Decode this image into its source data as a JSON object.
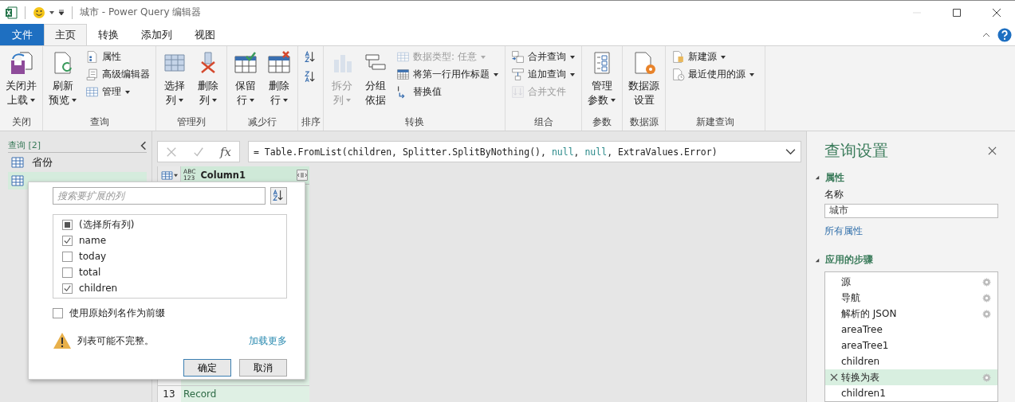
{
  "window": {
    "title": "城市 - Power Query 编辑器"
  },
  "tabs": [
    {
      "label": "文件",
      "kind": "file",
      "selected": false
    },
    {
      "label": "主页",
      "kind": "tab",
      "selected": true
    },
    {
      "label": "转换",
      "kind": "tab",
      "selected": false
    },
    {
      "label": "添加列",
      "kind": "tab",
      "selected": false
    },
    {
      "label": "视图",
      "kind": "tab",
      "selected": false
    }
  ],
  "ribbon": {
    "groups": [
      {
        "label": "关闭",
        "items": [
          {
            "kind": "large",
            "lines": [
              "关闭并",
              "上载"
            ],
            "dropdown": true,
            "disabled": false
          }
        ]
      },
      {
        "label": "查询",
        "items": [
          {
            "kind": "large",
            "lines": [
              "刷新",
              "预览"
            ],
            "dropdown": true,
            "disabled": false
          },
          {
            "kind": "stack",
            "children": [
              {
                "label": "属性",
                "dropdown": false,
                "disabled": false
              },
              {
                "label": "高级编辑器",
                "dropdown": false,
                "disabled": false
              },
              {
                "label": "管理",
                "dropdown": true,
                "disabled": false
              }
            ]
          }
        ]
      },
      {
        "label": "管理列",
        "items": [
          {
            "kind": "large",
            "lines": [
              "选择",
              "列"
            ],
            "dropdown": true,
            "disabled": false
          },
          {
            "kind": "large",
            "lines": [
              "删除",
              "列"
            ],
            "dropdown": true,
            "disabled": false
          }
        ]
      },
      {
        "label": "减少行",
        "items": [
          {
            "kind": "large",
            "lines": [
              "保留",
              "行"
            ],
            "dropdown": true,
            "disabled": false
          },
          {
            "kind": "large",
            "lines": [
              "删除",
              "行"
            ],
            "dropdown": true,
            "disabled": false
          }
        ]
      },
      {
        "label": "排序",
        "items": [
          {
            "kind": "icons"
          }
        ]
      },
      {
        "label": "转换",
        "items": [
          {
            "kind": "large",
            "lines": [
              "拆分",
              "列"
            ],
            "dropdown": true,
            "disabled": true
          },
          {
            "kind": "large",
            "lines": [
              "分组",
              "依据"
            ],
            "dropdown": false,
            "disabled": false
          },
          {
            "kind": "stack",
            "children": [
              {
                "label": "数据类型: 任意",
                "dropdown": true,
                "disabled": true
              },
              {
                "label": "将第一行用作标题",
                "dropdown": true,
                "disabled": false
              },
              {
                "label": "替换值",
                "dropdown": false,
                "disabled": false
              }
            ]
          }
        ]
      },
      {
        "label": "组合",
        "items": [
          {
            "kind": "stack",
            "children": [
              {
                "label": "合并查询",
                "dropdown": true,
                "disabled": false
              },
              {
                "label": "追加查询",
                "dropdown": true,
                "disabled": false
              },
              {
                "label": "合并文件",
                "dropdown": false,
                "disabled": true
              }
            ]
          }
        ]
      },
      {
        "label": "参数",
        "items": [
          {
            "kind": "large",
            "lines": [
              "管理",
              "参数"
            ],
            "dropdown": true,
            "disabled": false
          }
        ]
      },
      {
        "label": "数据源",
        "items": [
          {
            "kind": "large",
            "lines": [
              "数据源",
              "设置"
            ],
            "dropdown": false,
            "disabled": false
          }
        ]
      },
      {
        "label": "新建查询",
        "items": [
          {
            "kind": "stack",
            "children": [
              {
                "label": "新建源",
                "dropdown": true,
                "disabled": false
              },
              {
                "label": "最近使用的源",
                "dropdown": true,
                "disabled": false
              }
            ]
          }
        ]
      }
    ]
  },
  "queries_pane": {
    "header": "查询 [2]",
    "items": [
      {
        "label": "省份",
        "selected": false
      },
      {
        "selected": true
      }
    ]
  },
  "formula_bar": {
    "fx": "fx",
    "segments": [
      {
        "text": "= Table.FromList(children, Splitter.SplitByNothing(), ",
        "kind": "code"
      },
      {
        "text": "null",
        "kind": "keyword"
      },
      {
        "text": ", ",
        "kind": "code"
      },
      {
        "text": "null",
        "kind": "keyword"
      },
      {
        "text": ", ExtraValues.Error)",
        "kind": "code"
      }
    ]
  },
  "table": {
    "column": {
      "type": [
        "ABC",
        "123"
      ],
      "name": "Column1"
    },
    "rows": [
      {
        "index": "13",
        "value": "Record"
      }
    ]
  },
  "expand_popup": {
    "search": {
      "placeholder": "搜索要扩展的列"
    },
    "select_all": {
      "label": "(选择所有列)",
      "partial": true
    },
    "columns": [
      {
        "label": "name",
        "checked": true
      },
      {
        "label": "today",
        "checked": false
      },
      {
        "label": "total",
        "checked": false
      },
      {
        "label": "children",
        "checked": true
      }
    ],
    "prefix": {
      "label": "使用原始列名作为前缀",
      "checked": false
    },
    "warning": "列表可能不完整。",
    "load_more": "加载更多",
    "buttons": [
      {
        "label": "确定",
        "kind": "default"
      },
      {
        "label": "取消",
        "kind": "normal"
      }
    ]
  },
  "settings": {
    "title": "查询设置",
    "properties": {
      "heading": "属性",
      "expanded": true,
      "name_label": "名称",
      "name_value": "城市",
      "all_link": "所有属性"
    },
    "steps": {
      "heading": "应用的步骤",
      "expanded": true,
      "items": [
        {
          "label": "源",
          "settings": true,
          "selected": false
        },
        {
          "label": "导航",
          "settings": true,
          "selected": false
        },
        {
          "label": "解析的 JSON",
          "settings": true,
          "selected": false
        },
        {
          "label": "areaTree",
          "settings": false,
          "selected": false
        },
        {
          "label": "areaTree1",
          "settings": false,
          "selected": false
        },
        {
          "label": "children",
          "settings": false,
          "selected": false
        },
        {
          "label": "转换为表",
          "settings": true,
          "selected": true
        },
        {
          "label": "children1",
          "settings": false,
          "selected": false
        }
      ]
    }
  }
}
